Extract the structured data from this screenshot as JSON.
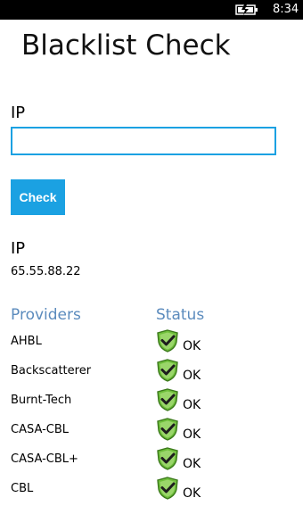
{
  "status_bar": {
    "time": "8:34",
    "battery_icon": "battery-charging-icon"
  },
  "title": "Blacklist Check",
  "form": {
    "ip_label": "IP",
    "ip_value": "",
    "check_label": "Check"
  },
  "result": {
    "ip_label": "IP",
    "ip_value": "65.55.88.22"
  },
  "table": {
    "providers_header": "Providers",
    "status_header": "Status",
    "status_icon": "shield-check-icon",
    "rows": [
      {
        "provider": "AHBL",
        "status": "OK"
      },
      {
        "provider": "Backscatterer",
        "status": "OK"
      },
      {
        "provider": "Burnt-Tech",
        "status": "OK"
      },
      {
        "provider": "CASA-CBL",
        "status": "OK"
      },
      {
        "provider": "CASA-CBL+",
        "status": "OK"
      },
      {
        "provider": "CBL",
        "status": "OK"
      }
    ]
  },
  "colors": {
    "accent": "#1ba1e2",
    "header": "#5b8bbd",
    "shield_green": "#6fbf3b"
  }
}
